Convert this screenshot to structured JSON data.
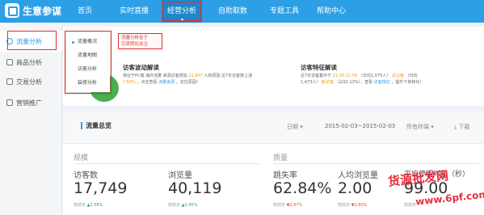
{
  "app": {
    "name": "生意参谋"
  },
  "nav": [
    {
      "label": "首页",
      "active": false
    },
    {
      "label": "实时直播",
      "active": false
    },
    {
      "label": "经营分析",
      "active": true
    },
    {
      "label": "自助取数",
      "active": false
    },
    {
      "label": "专题工具",
      "active": false
    },
    {
      "label": "帮助中心",
      "active": false
    }
  ],
  "sidebar": [
    {
      "label": "流量分析",
      "icon": "eye-icon",
      "active": true
    },
    {
      "label": "商品分析",
      "icon": "box-icon",
      "active": false
    },
    {
      "label": "交易分析",
      "icon": "cart-icon",
      "active": false
    },
    {
      "label": "营销推广",
      "icon": "megaphone-icon",
      "active": false
    }
  ],
  "flyout": [
    {
      "label": "流量概况",
      "active": true
    },
    {
      "label": "流量地图",
      "active": false
    },
    {
      "label": "访客分析",
      "active": false
    },
    {
      "label": "装修分析",
      "active": false
    }
  ],
  "callout": {
    "line1": "流量分析在于",
    "line2": "引流转化关注"
  },
  "visitor_wave": {
    "title": "访客波动解读",
    "line1_a": "得业于PC端  海外流量  来源访客增加",
    "line1_num": "21.807",
    "line1_b": "人的原因  近7天访客数上涨",
    "line2_num": "7.60%",
    "line2_a": "，点击查看",
    "line2_link": "流量来源",
    "line2_b": "，定位原因！"
  },
  "visitor_feature": {
    "title": "访客特征解读",
    "line1_a": "近7天访客集中于",
    "line1_time": "21:00-21:59",
    "line1_b": "（日均1,075人）",
    "line1_c": "关注度",
    "line1_d": "（日均",
    "line2_a": "1,473人）",
    "line2_b": "新访客",
    "line2_c": "（占92.13%），查看",
    "line2_link": "访客特征",
    "line2_d": "，提升下单转化！"
  },
  "overview": {
    "title": "流量总览",
    "date_label": "日期",
    "date_range": "2015-02-03~2015-02-03",
    "terminal": "所有终端",
    "download": "下载"
  },
  "groups": {
    "scale": "规模",
    "quality": "质量"
  },
  "metrics": [
    {
      "label": "访客数",
      "value": "17,749",
      "cmp_label": "较前日",
      "change": "2.58%",
      "dir": "up"
    },
    {
      "label": "浏览量",
      "value": "40,119",
      "cmp_label": "较前日",
      "change": "5.45%",
      "dir": "up"
    },
    {
      "label": "跳失率",
      "value": "62.84%",
      "cmp_label": "较前日",
      "change": "2.67%",
      "dir": "down"
    },
    {
      "label": "人均浏览量",
      "value": "2.00",
      "cmp_label": "较前日",
      "change": "2.60%",
      "dir": "down"
    },
    {
      "label": "平均停留时长（秒）",
      "value": "99.00",
      "cmp_label": "较前日",
      "change": "",
      "dir": "up"
    }
  ],
  "watermark": {
    "line1": "货源批发网",
    "line2": "www.6pf.com"
  },
  "colors": {
    "primary": "#2d9fe6",
    "accent_red": "#e03030",
    "up": "#2eaa5c",
    "down": "#e74c3c"
  }
}
